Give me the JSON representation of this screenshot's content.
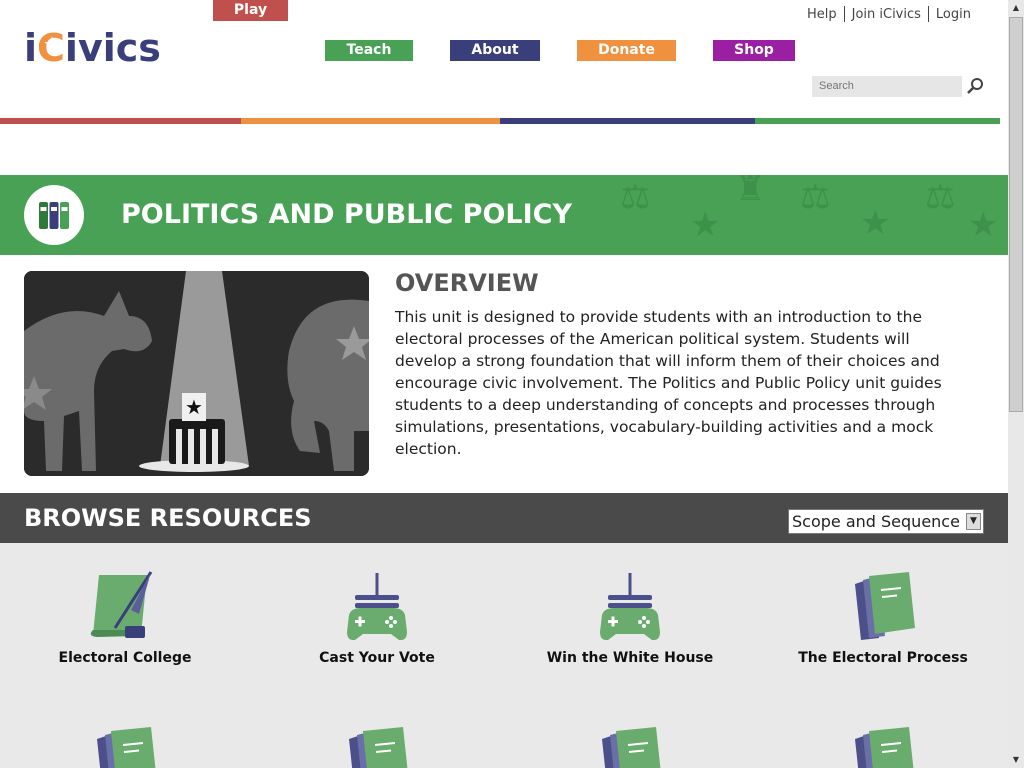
{
  "logo": {
    "text_i": "i",
    "text_c": "C",
    "text_rest": "ivics"
  },
  "nav": [
    {
      "label": "Play",
      "color": "#c0504d"
    },
    {
      "label": "Teach",
      "color": "#48a155"
    },
    {
      "label": "About",
      "color": "#3a3e7a"
    },
    {
      "label": "Donate",
      "color": "#f0913f"
    },
    {
      "label": "Shop",
      "color": "#9b1fa3"
    }
  ],
  "top_links": {
    "help": "Help",
    "join": "Join iCivics",
    "login": "Login"
  },
  "search": {
    "placeholder": "Search"
  },
  "banner": {
    "title": "POLITICS AND PUBLIC POLICY"
  },
  "overview": {
    "title": "OVERVIEW",
    "text": "This unit is designed to provide students with an introduction to the electoral processes of the American political system. Students will develop a strong foundation that will inform them of their choices and encourage civic involvement. The Politics and Public Policy unit guides students to a deep understanding of concepts and processes through simulations, presentations, vocabulary-building activities and a mock election."
  },
  "browse": {
    "title": "BROWSE RESOURCES",
    "select_value": "Scope and Sequence"
  },
  "resources": [
    {
      "label": "Electoral College",
      "icon": "scroll-quill-icon"
    },
    {
      "label": "Cast Your Vote",
      "icon": "game-controller-icon"
    },
    {
      "label": "Win the White House",
      "icon": "game-controller-icon"
    },
    {
      "label": "The Electoral Process",
      "icon": "lesson-plan-icon"
    }
  ],
  "colors": {
    "red": "#c0504d",
    "orange": "#f0913f",
    "navy": "#3a3e7a",
    "green": "#48a155"
  }
}
